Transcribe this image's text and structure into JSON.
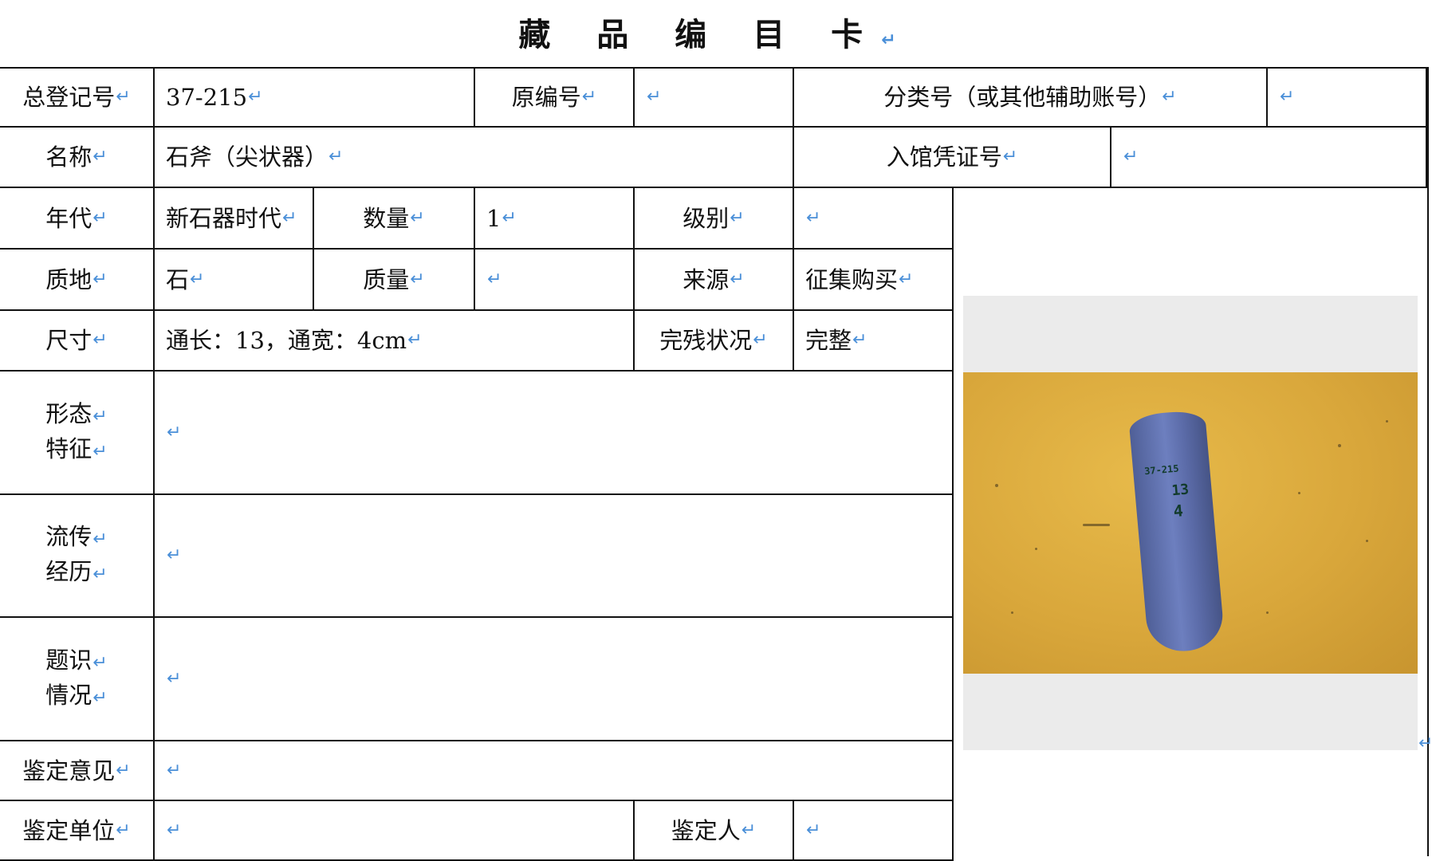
{
  "title": "藏 品 编 目 卡",
  "return_mark": "↵",
  "fields": {
    "reg_no_label": "总登记号",
    "reg_no_value": "37-215",
    "orig_no_label": "原编号",
    "orig_no_value": "",
    "class_no_label": "分类号（或其他辅助账号）",
    "class_no_value": "",
    "name_label": "名称",
    "name_value": "石斧（尖状器）",
    "voucher_label": "入馆凭证号",
    "voucher_value": "",
    "era_label": "年代",
    "era_value": "新石器时代",
    "qty_label": "数量",
    "qty_value": "1",
    "grade_label": "级别",
    "grade_value": "",
    "material_label": "质地",
    "material_value": "石",
    "mass_label": "质量",
    "mass_value": "",
    "source_label": "来源",
    "source_value": "征集购买",
    "size_label": "尺寸",
    "size_value": "通长：13，通宽：4cm",
    "condition_label": "完残状况",
    "condition_value": "完整",
    "form_label_1": "形态",
    "form_label_2": "特征",
    "form_value": "",
    "history_label_1": "流传",
    "history_label_2": "经历",
    "history_value": "",
    "inscription_label_1": "题识",
    "inscription_label_2": "情况",
    "inscription_value": "",
    "opinion_label": "鉴定意见",
    "opinion_value": "",
    "unit_label": "鉴定单位",
    "unit_value": "",
    "appraiser_label": "鉴定人",
    "appraiser_value": ""
  },
  "photo": {
    "mark_line1": "37-215",
    "mark_line2": "13",
    "mark_line3": "4"
  }
}
